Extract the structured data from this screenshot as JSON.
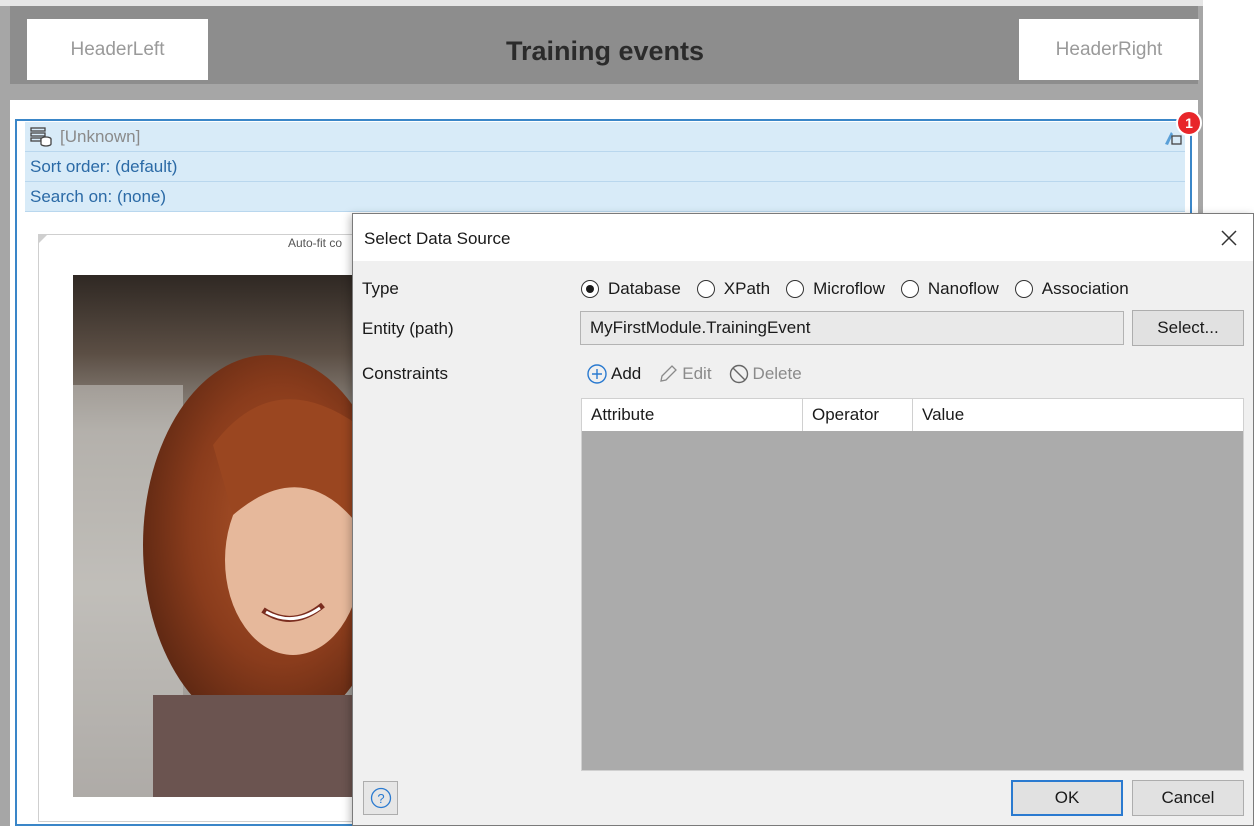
{
  "page": {
    "header_left": "HeaderLeft",
    "header_title": "Training events",
    "header_right": "HeaderRight",
    "dataview": {
      "entity": "[Unknown]",
      "sort_order": "Sort order: (default)",
      "search_on": "Search on: (none)",
      "error_count": "1"
    },
    "autofit_label": "Auto-fit co"
  },
  "dialog": {
    "title": "Select Data Source",
    "type_label": "Type",
    "type_options": [
      "Database",
      "XPath",
      "Microflow",
      "Nanoflow",
      "Association"
    ],
    "type_selected": "Database",
    "entity_label": "Entity (path)",
    "entity_value": "MyFirstModule.TrainingEvent",
    "select_button": "Select...",
    "constraints_label": "Constraints",
    "toolbar": {
      "add": "Add",
      "edit": "Edit",
      "delete": "Delete"
    },
    "grid_columns": [
      "Attribute",
      "Operator",
      "Value"
    ],
    "ok_button": "OK",
    "cancel_button": "Cancel"
  },
  "colors": {
    "accent": "#2a7ad0",
    "selection_blue": "#d8ebf8",
    "error_badge": "#e8262a"
  }
}
